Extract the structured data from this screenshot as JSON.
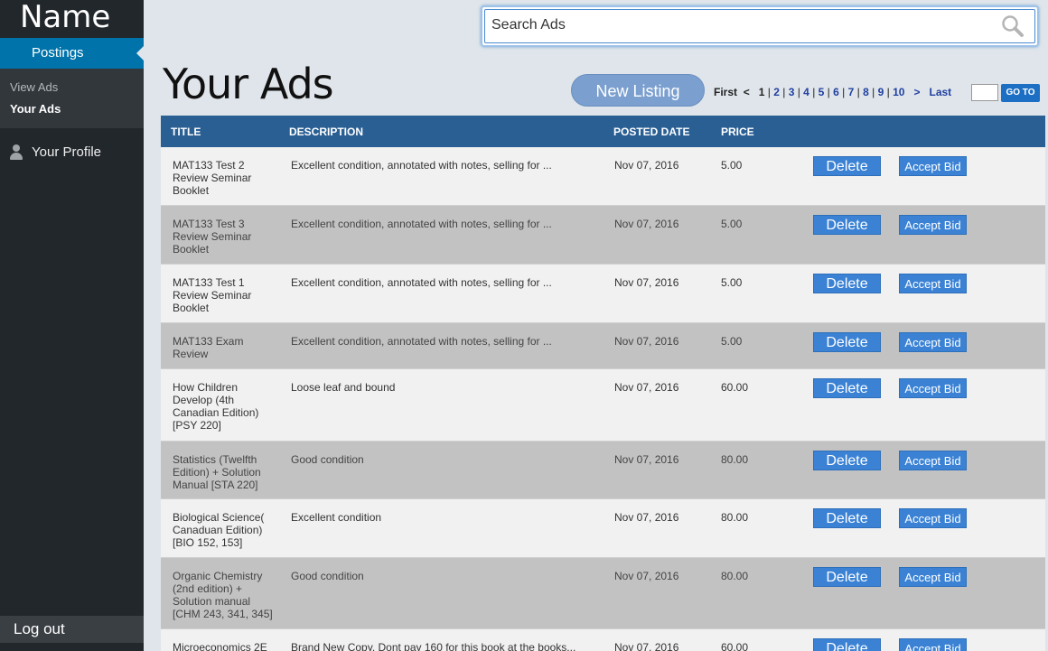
{
  "sidebar": {
    "brand": "Name",
    "active_item": "Postings",
    "submenu": [
      {
        "label": "View Ads"
      },
      {
        "label": "Your Ads"
      }
    ],
    "profile_label": "Your Profile",
    "logout_label": "Log out"
  },
  "search": {
    "placeholder": "Search Ads"
  },
  "main": {
    "title": "Your Ads",
    "new_listing_label": "New Listing"
  },
  "pagination": {
    "first": "First",
    "prev": "<",
    "pages": [
      "1",
      "2",
      "3",
      "4",
      "5",
      "6",
      "7",
      "8",
      "9",
      "10"
    ],
    "current_page": "1",
    "next": ">",
    "last": "Last",
    "goto_label": "GO TO"
  },
  "table": {
    "headers": {
      "title": "TITLE",
      "description": "DESCRIPTION",
      "posted_date": "POSTED DATE",
      "price": "PRICE"
    },
    "delete_label": "Delete",
    "accept_label": "Accept Bid",
    "rows": [
      {
        "title": "MAT133 Test 2 Review Seminar Booklet",
        "description": "Excellent condition, annotated with notes, selling for ...",
        "date": "Nov 07, 2016",
        "price": "5.00"
      },
      {
        "title": "MAT133 Test 3 Review Seminar Booklet",
        "description": "Excellent condition, annotated with notes, selling for ...",
        "date": "Nov 07, 2016",
        "price": "5.00"
      },
      {
        "title": "MAT133 Test 1 Review Seminar Booklet",
        "description": "Excellent condition, annotated with notes, selling for ...",
        "date": "Nov 07, 2016",
        "price": "5.00"
      },
      {
        "title": "MAT133 Exam Review",
        "description": "Excellent condition, annotated with notes, selling for ...",
        "date": "Nov 07, 2016",
        "price": "5.00"
      },
      {
        "title": "How Children Develop (4th Canadian Edition) [PSY 220]",
        "description": "Loose leaf and bound",
        "date": "Nov 07, 2016",
        "price": "60.00"
      },
      {
        "title": "Statistics (Twelfth Edition) + Solution Manual [STA 220]",
        "description": "Good condition",
        "date": "Nov 07, 2016",
        "price": "80.00"
      },
      {
        "title": "Biological Science( Canaduan Edition) [BIO 152, 153]",
        "description": "Excellent condition",
        "date": "Nov 07, 2016",
        "price": "80.00"
      },
      {
        "title": "Organic Chemistry (2nd edition) + Solution manual [CHM 243, 341, 345]",
        "description": "Good condition",
        "date": "Nov 07, 2016",
        "price": "80.00"
      },
      {
        "title": "Microeconomics 2E",
        "description": "Brand New Copy. Dont pay 160 for this book at the books...",
        "date": "Nov 07, 2016",
        "price": "60.00"
      }
    ]
  }
}
